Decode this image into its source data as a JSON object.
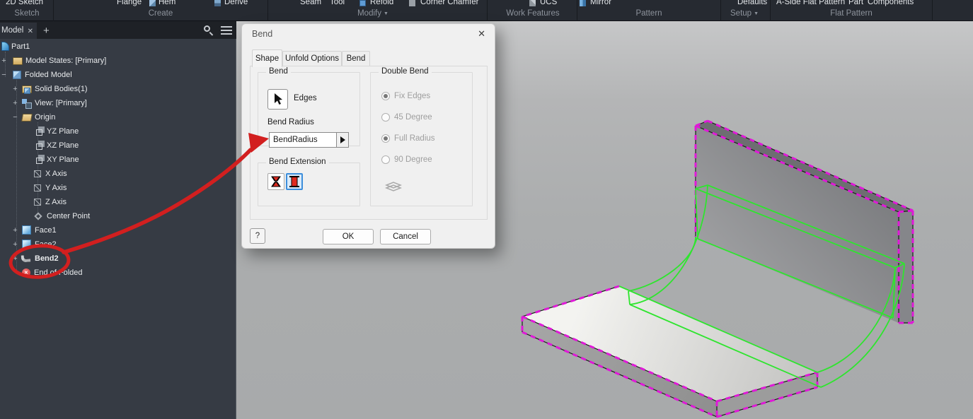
{
  "ribbon": {
    "items": [
      {
        "label": "2D Sketch"
      },
      {
        "label": "Flange"
      },
      {
        "label": "Hem"
      },
      {
        "label": "Derive"
      },
      {
        "label": "Seam"
      },
      {
        "label": "Tool"
      },
      {
        "label": "Refold"
      },
      {
        "label": "Corner Chamfer"
      },
      {
        "label": "UCS"
      },
      {
        "label": "Mirror"
      },
      {
        "label": "Defaults"
      },
      {
        "label": "A-Side Flat Pattern"
      },
      {
        "label": "Part"
      },
      {
        "label": "Components"
      }
    ],
    "groups": [
      {
        "label": "Sketch"
      },
      {
        "label": "Create"
      },
      {
        "label": "Modify"
      },
      {
        "label": "Work Features"
      },
      {
        "label": "Pattern"
      },
      {
        "label": "Setup"
      },
      {
        "label": "Flat Pattern"
      }
    ]
  },
  "browser": {
    "tab_label": "Model",
    "close": "✕",
    "add": "+"
  },
  "tree": {
    "items": [
      {
        "label": "Part1"
      },
      {
        "label": "Model States: [Primary]"
      },
      {
        "label": "Folded Model"
      },
      {
        "label": "Solid Bodies(1)"
      },
      {
        "label": "View: [Primary]"
      },
      {
        "label": "Origin"
      },
      {
        "label": "YZ Plane"
      },
      {
        "label": "XZ Plane"
      },
      {
        "label": "XY Plane"
      },
      {
        "label": "X Axis"
      },
      {
        "label": "Y Axis"
      },
      {
        "label": "Z Axis"
      },
      {
        "label": "Center Point"
      },
      {
        "label": "Face1"
      },
      {
        "label": "Face2"
      },
      {
        "label": "Bend2"
      },
      {
        "label": "End of Folded"
      }
    ]
  },
  "dialog": {
    "title": "Bend",
    "close": "✕",
    "tabs": [
      {
        "label": "Shape"
      },
      {
        "label": "Unfold Options"
      },
      {
        "label": "Bend"
      }
    ],
    "bend_group": "Bend",
    "edges_label": "Edges",
    "bend_radius_label": "Bend Radius",
    "bend_radius_value": "BendRadius",
    "bend_extension_group": "Bend Extension",
    "double_bend_group": "Double Bend",
    "radios": [
      {
        "label": "Fix Edges",
        "selected": true
      },
      {
        "label": "45 Degree",
        "selected": false
      },
      {
        "label": "Full Radius",
        "selected": true
      },
      {
        "label": "90 Degree",
        "selected": false
      }
    ],
    "ok": "OK",
    "cancel": "Cancel",
    "help": "?"
  },
  "annotation": {
    "color": "#d21f1f"
  },
  "viewport": {
    "edge_dash_color": "#e018d8",
    "preview_color": "#2ee52e"
  }
}
